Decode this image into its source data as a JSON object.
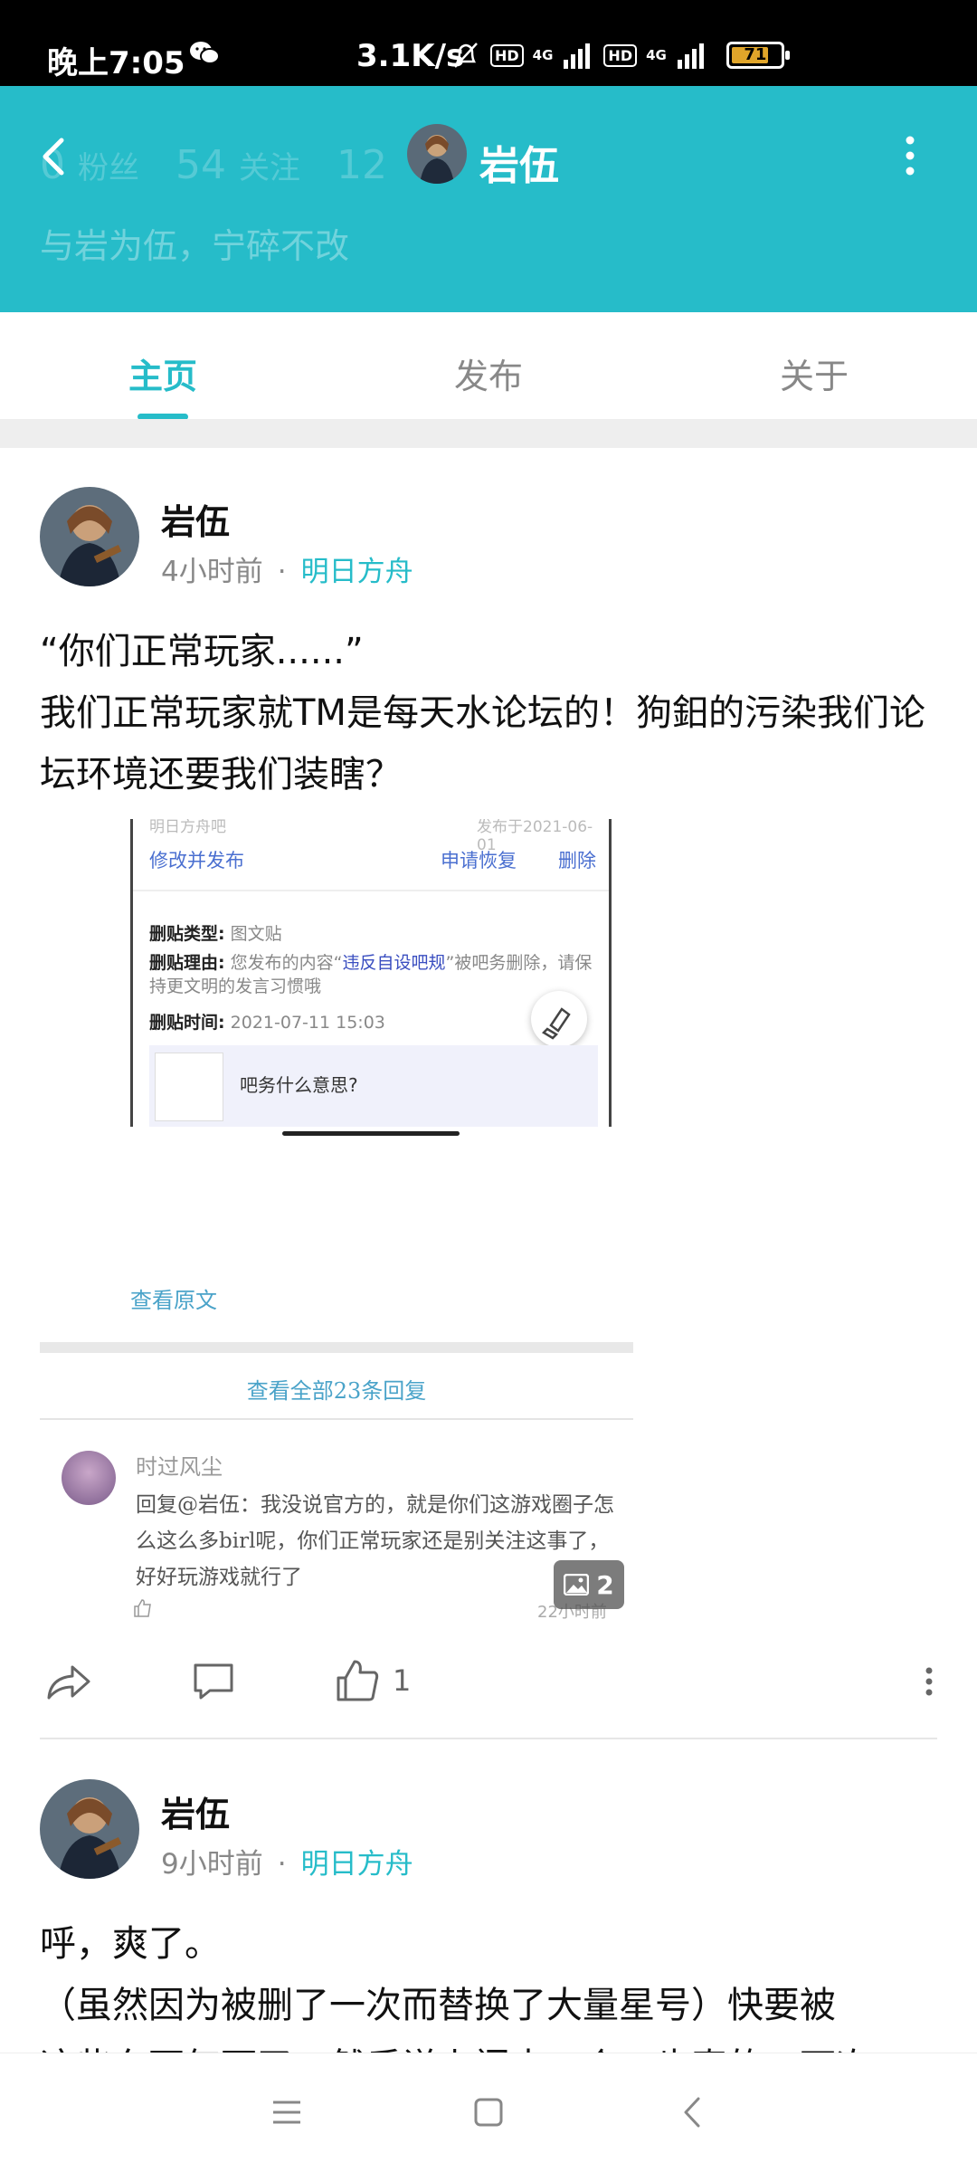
{
  "status_bar": {
    "time": "晚上7:05",
    "net_speed": "3.1K/s",
    "network_1": "4G",
    "network_2": "4G",
    "hd_1": "HD",
    "hd_2": "HD",
    "battery": "71",
    "icons": [
      "wechat-icon",
      "mute-bell-icon",
      "signal-icon",
      "battery-icon"
    ]
  },
  "header": {
    "title": "岩伍",
    "fans_count": "0",
    "fans_label": "粉丝",
    "follow_count": "54",
    "follow_label": "关注",
    "third_count": "12",
    "bio": "与岩为伍，宁碎不改",
    "background_color": "#26bcc9"
  },
  "tabs": [
    {
      "label": "主页",
      "active": true
    },
    {
      "label": "发布",
      "active": false
    },
    {
      "label": "关于",
      "active": false
    }
  ],
  "posts": [
    {
      "author": "岩伍",
      "time": "4小时前",
      "forum": "明日方舟",
      "text_line1": "“你们正常玩家......”",
      "text_line2": "我们正常玩家就TM是每天水论坛的！狗鈤的污染我们论坛环境还要我们装瞎？",
      "image_count": "2",
      "like_count": "1",
      "preview": {
        "top_left_faint": "明日方舟吧",
        "top_right_faint": "发布于2021-06-01",
        "edit_label": "修改并发布",
        "request_label": "申请恢复",
        "delete_label": "删除",
        "type_key": "删贴类型:",
        "type_val": "图文贴",
        "reason_key": "删贴理由:",
        "reason_pre": "您发布的内容“",
        "reason_hl": "违反自设吧规",
        "reason_post": "”被吧务删除，请保持更文明的发言习惯哦",
        "time_key": "删贴时间:",
        "time_val": "2021-07-11 15:03",
        "quote": "吧务什么意思?",
        "view_original": "查看原文",
        "view_all": "查看全部23条回复",
        "reply_user": "时过风尘",
        "reply_text": "回复@岩伍：我没说官方的，就是你们这游戏圈子怎么这么多birl呢，你们正常玩家还是别关注这事了，好好玩游戏就行了",
        "reply_time": "22小时前"
      }
    },
    {
      "author": "岩伍",
      "time": "9小时前",
      "forum": "明日方舟",
      "text_line1": "呼，爽了。",
      "text_line2": "（虽然因为被删了一次而替换了大量星号）快要被",
      "text_line3": "这些东西气死了，然后说上门来一个，也真的，下次"
    }
  ],
  "accent_color": "#26bcc9"
}
